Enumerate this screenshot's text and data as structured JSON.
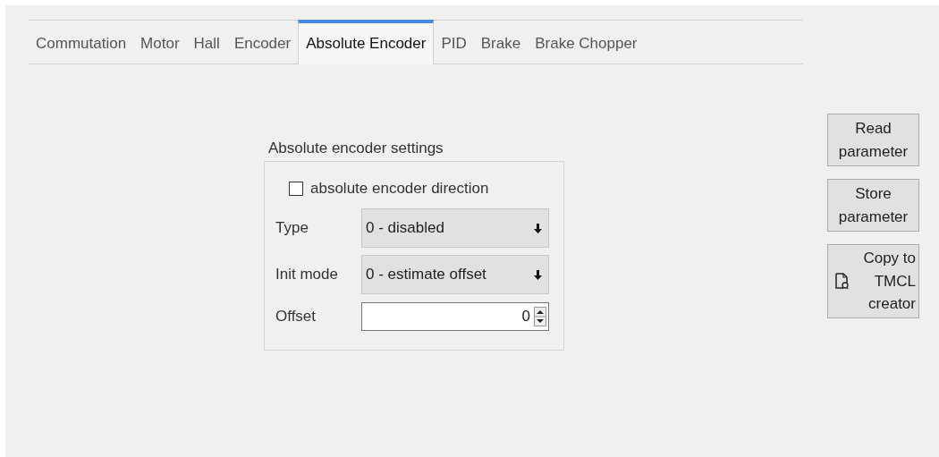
{
  "tabs": [
    {
      "label": "Commutation",
      "selected": false
    },
    {
      "label": "Motor",
      "selected": false
    },
    {
      "label": "Hall",
      "selected": false
    },
    {
      "label": "Encoder",
      "selected": false
    },
    {
      "label": "Absolute Encoder",
      "selected": true
    },
    {
      "label": "PID",
      "selected": false
    },
    {
      "label": "Brake",
      "selected": false
    },
    {
      "label": "Brake Chopper",
      "selected": false
    }
  ],
  "group": {
    "title": "Absolute encoder settings",
    "checkbox": {
      "label": "absolute encoder direction",
      "checked": false
    },
    "fields": [
      {
        "kind": "select",
        "label": "Type",
        "value": "0 - disabled"
      },
      {
        "kind": "select",
        "label": "Init mode",
        "value": "0 - estimate offset"
      },
      {
        "kind": "spin",
        "label": "Offset",
        "value": "0"
      }
    ]
  },
  "buttons": [
    {
      "kind": "plain",
      "label": "Read\nparameter"
    },
    {
      "kind": "plain",
      "label": "Store\nparameter"
    },
    {
      "kind": "icon",
      "label": "Copy to\nTMCL\ncreator"
    }
  ]
}
